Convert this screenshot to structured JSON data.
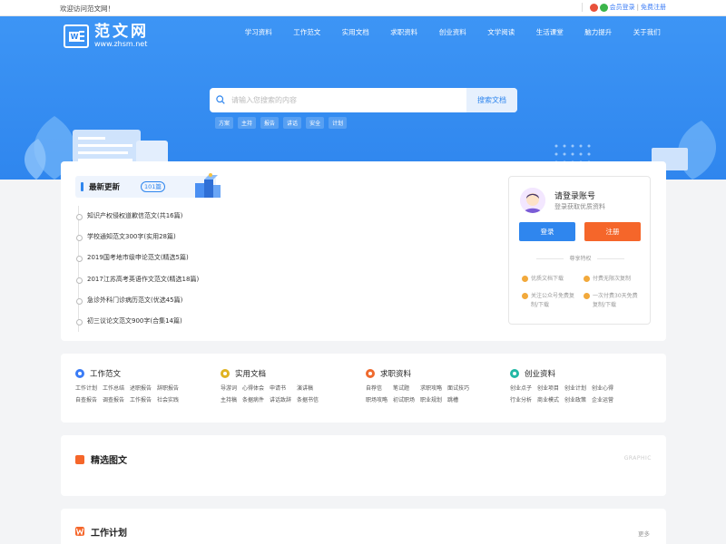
{
  "topbar": {
    "welcome": "欢迎访问范文网！",
    "member_login": "会员登录",
    "divider": "|",
    "free_register": "免费注册"
  },
  "logo": {
    "name": "范文网",
    "domain": "www.zhsm.net"
  },
  "nav": [
    "学习资料",
    "工作范文",
    "实用文档",
    "求职资料",
    "创业资料",
    "文学阅读",
    "生活课堂",
    "脑力提升",
    "关于我们"
  ],
  "search": {
    "placeholder": "请输入您搜索的内容",
    "button": "搜索文档"
  },
  "hot_words": [
    "方案",
    "主持",
    "报告",
    "讲话",
    "安全",
    "计划"
  ],
  "latest": {
    "title": "最新更新",
    "count_badge": "101篇",
    "items": [
      "知识产权侵权道歉信范文(共16篇)",
      "学校通知范文300字(实用28篇)",
      "2019国考地市级申论范文(精选5篇)",
      "2017江苏高考英语作文范文(精选18篇)",
      "急诊外科门诊病历范文(优选45篇)",
      "初三议论文范文900字(合集14篇)"
    ]
  },
  "login": {
    "title": "请登录账号",
    "subtitle": "登录获取优质资料",
    "login_button": "登录",
    "register_button": "注册",
    "privileges_title": "尊享特权",
    "perks": [
      "优质文档下载",
      "付费无限次复制",
      "关注公众号免费复制/下载",
      "一次付费30天免费复制/下载"
    ]
  },
  "categories": [
    {
      "title": "工作范文",
      "color": "#3b7cf6",
      "links": [
        "工作计划",
        "工作总结",
        "述职报告",
        "辞职报告",
        "自查报告",
        "调查报告",
        "工作报告",
        "社会实践"
      ]
    },
    {
      "title": "实用文档",
      "color": "#e0b322",
      "links": [
        "导游词",
        "心得体会",
        "申请书",
        "演讲稿",
        "主持稿",
        "条据病件",
        "讲话致辞",
        "条据书信"
      ]
    },
    {
      "title": "求职资料",
      "color": "#ef6a2e",
      "links": [
        "自荐信",
        "笔试题",
        "求职攻略",
        "面试技巧",
        "职场攻略",
        "初试职场",
        "职业规划",
        "跳槽"
      ]
    },
    {
      "title": "创业资料",
      "color": "#22b8a5",
      "links": [
        "创业点子",
        "创业项目",
        "创业计划",
        "创业心得",
        "行业分析",
        "商业模式",
        "创业政策",
        "企业运营"
      ]
    }
  ],
  "featured": {
    "title": "精选图文",
    "tag": "GRAPHIC"
  },
  "work_plan": {
    "title": "工作计划",
    "more": "更多"
  },
  "colors": {
    "primary": "#2f86ee",
    "register": "#f5662a",
    "page_bg": "#f3f4f6"
  }
}
